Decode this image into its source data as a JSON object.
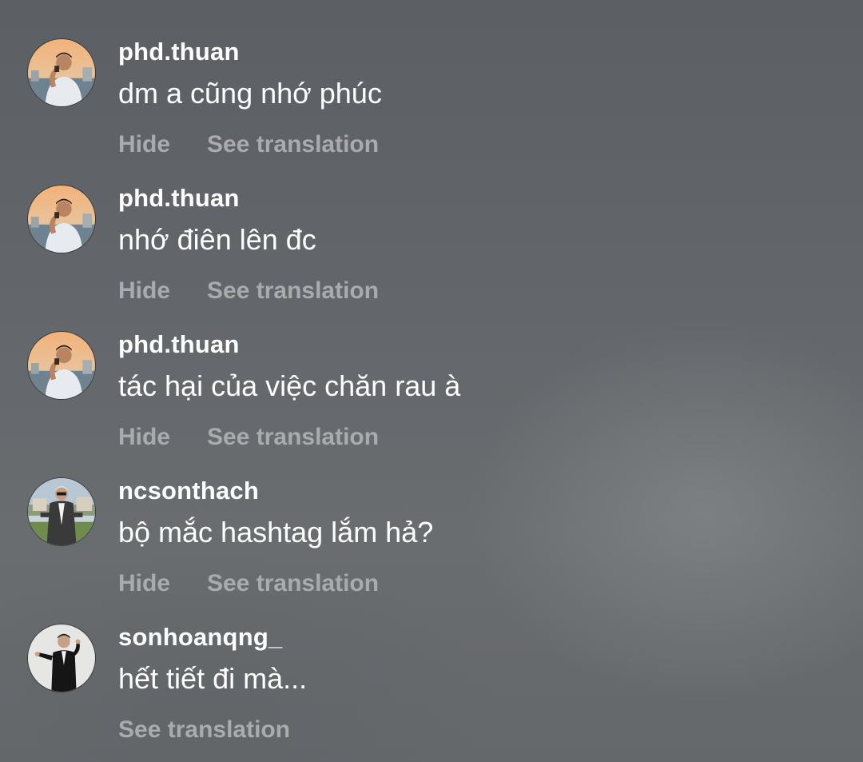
{
  "comments": [
    {
      "username": "phd.thuan",
      "text": "dm a cũng nhớ phúc",
      "hide_label": "Hide",
      "translate_label": "See translation",
      "avatar": "avatar-sunset"
    },
    {
      "username": "phd.thuan",
      "text": "nhớ điên lên đc",
      "hide_label": "Hide",
      "translate_label": "See translation",
      "avatar": "avatar-sunset"
    },
    {
      "username": "phd.thuan",
      "text": "tác hại của việc chăn rau à",
      "hide_label": "Hide",
      "translate_label": "See translation",
      "avatar": "avatar-sunset"
    },
    {
      "username": "ncsonthach",
      "text": "bộ mắc hashtag lắm hả?",
      "hide_label": "Hide",
      "translate_label": "See translation",
      "avatar": "avatar-suit-outdoor"
    },
    {
      "username": "sonhoanqng_",
      "text": "hết tiết đi mà...",
      "translate_label": "See translation",
      "avatar": "avatar-suit-studio"
    }
  ],
  "colors": {
    "background": "#616468",
    "username": "#ffffff",
    "comment_text": "#ffffff",
    "action_text": "#a9abad"
  }
}
